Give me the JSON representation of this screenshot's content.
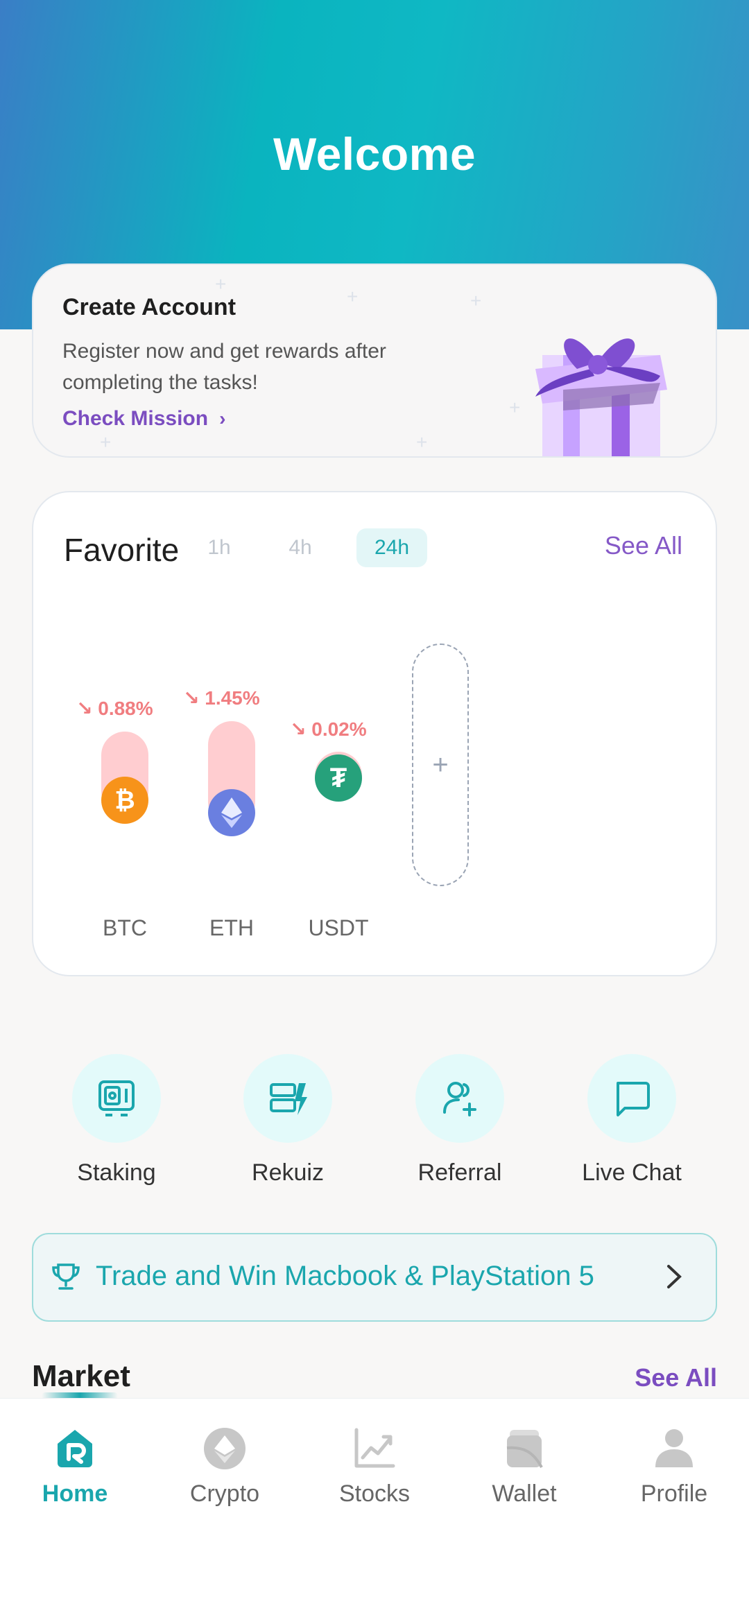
{
  "header": {
    "title": "Welcome"
  },
  "create_account": {
    "title": "Create Account",
    "description": "Register now and get rewards after completing the tasks!",
    "link": "Check Mission",
    "link_icon": "chevron-right-icon"
  },
  "favorite": {
    "title": "Favorite",
    "timeframes": [
      "1h",
      "4h",
      "24h"
    ],
    "selected_timeframe": "24h",
    "see_all": "See All",
    "coins": [
      {
        "symbol": "BTC",
        "change": "0.88%",
        "trend": "down",
        "color": "#f7931a"
      },
      {
        "symbol": "ETH",
        "change": "1.45%",
        "trend": "down",
        "color": "#6a7fe0"
      },
      {
        "symbol": "USDT",
        "change": "0.02%",
        "trend": "down",
        "color": "#26a17b"
      }
    ],
    "add_icon": "plus-icon"
  },
  "quick_actions": [
    {
      "label": "Staking",
      "icon": "safe-icon"
    },
    {
      "label": "Rekuiz",
      "icon": "quiz-icon"
    },
    {
      "label": "Referral",
      "icon": "add-user-icon"
    },
    {
      "label": "Live Chat",
      "icon": "chat-icon"
    }
  ],
  "promo": {
    "text": "Trade and Win Macbook & PlayStation 5",
    "icon": "trophy-icon"
  },
  "market": {
    "title": "Market",
    "see_all": "See All"
  },
  "tabs": [
    {
      "label": "Home",
      "icon": "home-icon",
      "active": true
    },
    {
      "label": "Crypto",
      "icon": "crypto-icon",
      "active": false
    },
    {
      "label": "Stocks",
      "icon": "stocks-icon",
      "active": false
    },
    {
      "label": "Wallet",
      "icon": "wallet-icon",
      "active": false
    },
    {
      "label": "Profile",
      "icon": "profile-icon",
      "active": false
    }
  ],
  "colors": {
    "accent": "#1aa6ad",
    "purple": "#7b4dc0",
    "negative": "#f07d80"
  }
}
